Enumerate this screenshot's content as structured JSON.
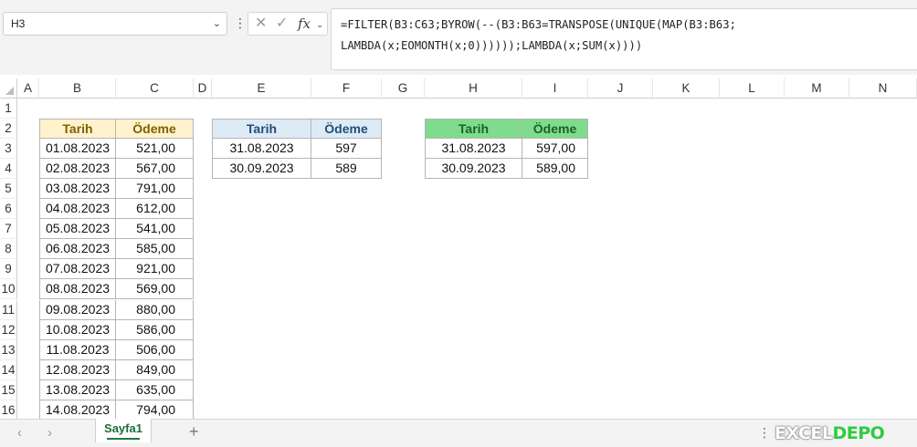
{
  "formula_bar": {
    "name_box": "H3",
    "formula_line1": "=FILTER(B3:C63;BYROW(--(B3:B63=TRANSPOSE(UNIQUE(MAP(B3:B63;",
    "formula_line2": "LAMBDA(x;EOMONTH(x;0))))));LAMBDA(x;SUM(x))))"
  },
  "columns": [
    "A",
    "B",
    "C",
    "D",
    "E",
    "F",
    "G",
    "H",
    "I",
    "J",
    "K",
    "L",
    "M",
    "N"
  ],
  "rows": [
    "1",
    "2",
    "3",
    "4",
    "5",
    "6",
    "7",
    "8",
    "9",
    "10",
    "11",
    "12",
    "13",
    "14",
    "15",
    "16"
  ],
  "source_table": {
    "headers": [
      "Tarih",
      "Ödeme"
    ],
    "rows": [
      [
        "01.08.2023",
        "521,00"
      ],
      [
        "02.08.2023",
        "567,00"
      ],
      [
        "03.08.2023",
        "791,00"
      ],
      [
        "04.08.2023",
        "612,00"
      ],
      [
        "05.08.2023",
        "541,00"
      ],
      [
        "06.08.2023",
        "585,00"
      ],
      [
        "07.08.2023",
        "921,00"
      ],
      [
        "08.08.2023",
        "569,00"
      ],
      [
        "09.08.2023",
        "880,00"
      ],
      [
        "10.08.2023",
        "586,00"
      ],
      [
        "11.08.2023",
        "506,00"
      ],
      [
        "12.08.2023",
        "849,00"
      ],
      [
        "13.08.2023",
        "635,00"
      ],
      [
        "14.08.2023",
        "794,00"
      ]
    ]
  },
  "summary_table": {
    "headers": [
      "Tarih",
      "Ödeme"
    ],
    "rows": [
      [
        "31.08.2023",
        "597"
      ],
      [
        "30.09.2023",
        "589"
      ]
    ]
  },
  "result_table": {
    "headers": [
      "Tarih",
      "Ödeme"
    ],
    "rows": [
      [
        "31.08.2023",
        "597,00"
      ],
      [
        "30.09.2023",
        "589,00"
      ]
    ]
  },
  "tabs": {
    "sheet_name": "Sayfa1",
    "add_label": "+"
  },
  "watermark": {
    "part1": "EXCEL",
    "part2": "DEPO"
  },
  "colors": {
    "source_header_bg": "#fff2cc",
    "summary_header_bg": "#ddebf7",
    "result_header_bg": "#7fdc8c",
    "active_tab": "#1e7b45"
  },
  "icons": {
    "namebox_dropdown": "chevron-down-icon",
    "cancel": "close-icon",
    "enter": "check-icon",
    "function": "fx-icon",
    "prev_sheet": "chevron-left-icon",
    "next_sheet": "chevron-right-icon"
  }
}
